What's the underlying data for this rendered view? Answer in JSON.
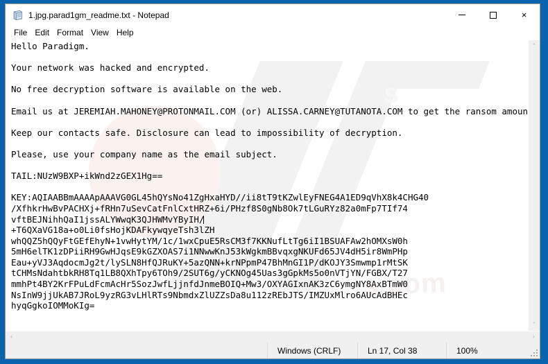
{
  "window": {
    "title": "1.jpg.parad1gm_readme.txt - Notepad",
    "icon": "notepad-icon",
    "controls": {
      "minimize": "–",
      "maximize": "□",
      "close": "×"
    }
  },
  "menu": {
    "items": [
      {
        "label": "File"
      },
      {
        "label": "Edit"
      },
      {
        "label": "Format"
      },
      {
        "label": "View"
      },
      {
        "label": "Help"
      }
    ]
  },
  "document": {
    "lines": [
      "Hello Paradigm.",
      "",
      "Your network was hacked and encrypted.",
      "",
      "No free decryption software is available on the web.",
      "",
      "Email us at JEREMIAH.MAHONEY@PROTONMAIL.COM (or) ALISSA.CARNEY@TUTANOTA.COM to get the ransom amount.",
      "",
      "Keep our contacts safe. Disclosure can lead to impossibility of decryption.",
      "",
      "Please, use your company name as the email subject.",
      "",
      "TAIL:NUzW9BXP+ikWnd2zGEX1Hg==",
      "",
      "KEY:AQIAABBmAAAApAAAVG0GL45hQYsNo41ZgHxaHYD//ii8tT9tKZwlEyFNEG4A1ED9qVhX8k4CHG40",
      "/XfhkrHwBvPACHXj+fRHn7uSevCatFnlCxtHRZ+6i/PHzf8S0gNb8Ok7tLGuRYz82a0mFp7TIf74",
      "vftBEJNihhQaI1jssALYWwqK3QJHWMvYByIH/",
      "+T6QXaVG18a+o0Li0fsHojKDAFkywqyeTsh3lZH",
      "whQQZ5hQQyFtGEfEhyN+1vwHytYM/1c/1wxCpuE5RsCM3f7KKNufLtTg6iI1BSUAFAw2hOMXsW0h",
      "5mH6elTK1zDPiiRH9GwHJqsE9kGZXOAS7i1NNwwKnJ53kWgkmBBvqxgNKUFd65JV4dH5ir8WmPHp",
      "Eau+yVJ3AqdocmJg2t/lySLN8HfQJRuKY+5azQNN+krNPpmP47BhMnGI1P/dKOJY3Smwmp1rMtSK",
      "tCHMsNdahtbkRH8Tq1LB8QXhTpy6TOh9/2SUT6g/yCKNOg45Uas3gGpkMs5o0nVTjYN/FGBX/T27",
      "mmhPt4BY2KrFPuLdFcmAcHr5SozJwfLjjnfdJnmeBOIQ+Mw3/OXYAGIxnAK3zC6ymgNY8AxBTmW0",
      "NsInW9jjUkAB7JRoL9yzRG3vLHlRTs9NbmdxZlUZZsDa8u112zREbJTS/IMZUxMlro6AUcAdBHEc",
      "hyqGgkoIOMMoKIg="
    ],
    "caret_line_index": 16,
    "caret_prefix": "vftBEJNihhQaI1jssALYWwqK3QJHWMvYByIH/"
  },
  "scrollbars": {
    "vertical_up": "˄",
    "vertical_down": "˅",
    "horizontal_left": "‹",
    "horizontal_right": "›"
  },
  "statusbar": {
    "line_ending": "Windows (CRLF)",
    "cursor_position": "Ln 17, Col 38",
    "zoom": "100%"
  },
  "colors": {
    "desktop": "#0a64ad",
    "window": "#ffffff",
    "statusbar": "#f0f0f0",
    "scrollbar": "#f0f0f0",
    "text": "#000000"
  }
}
